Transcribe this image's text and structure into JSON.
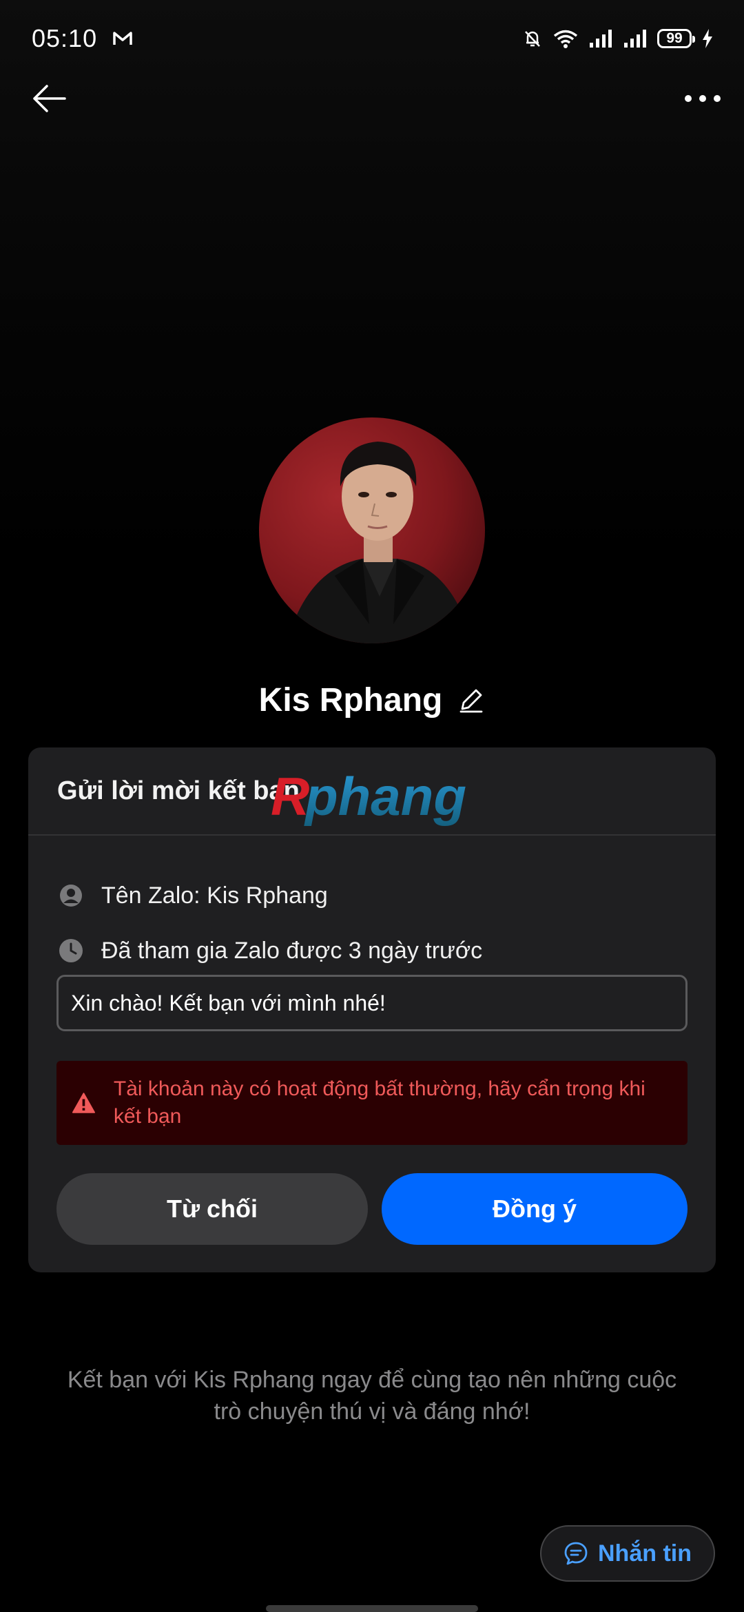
{
  "status_bar": {
    "time": "05:10",
    "battery_level": "99"
  },
  "profile": {
    "name": "Kis Rphang"
  },
  "card": {
    "title": "Gửi lời mời kết bạn",
    "watermark": "Rphang",
    "zalo_name": "Tên Zalo: Kis Rphang",
    "joined": "Đã tham gia Zalo được 3 ngày trước",
    "greeting_message": "Xin chào! Kết bạn với mình nhé!",
    "warning": "Tài khoản này có hoạt động bất thường, hãy cẩn trọng khi kết bạn",
    "decline_label": "Từ chối",
    "accept_label": "Đồng ý"
  },
  "footer": {
    "text": "Kết bạn với Kis Rphang ngay để cùng tạo nên những cuộc trò chuyện thú vị và đáng nhớ!"
  },
  "message_button": {
    "label": "Nhắn tin"
  },
  "colors": {
    "accent": "#0068ff",
    "warning_text": "#f05a5a",
    "warning_bg": "#2b0002",
    "message_label": "#4aa0ff"
  },
  "icons": [
    "mail-icon",
    "mute-bell-icon",
    "wifi-icon",
    "signal-icon",
    "battery-icon",
    "charging-icon",
    "back-arrow-icon",
    "more-icon",
    "edit-pencil-icon",
    "user-icon",
    "clock-icon",
    "warning-icon",
    "chat-bubble-icon"
  ]
}
